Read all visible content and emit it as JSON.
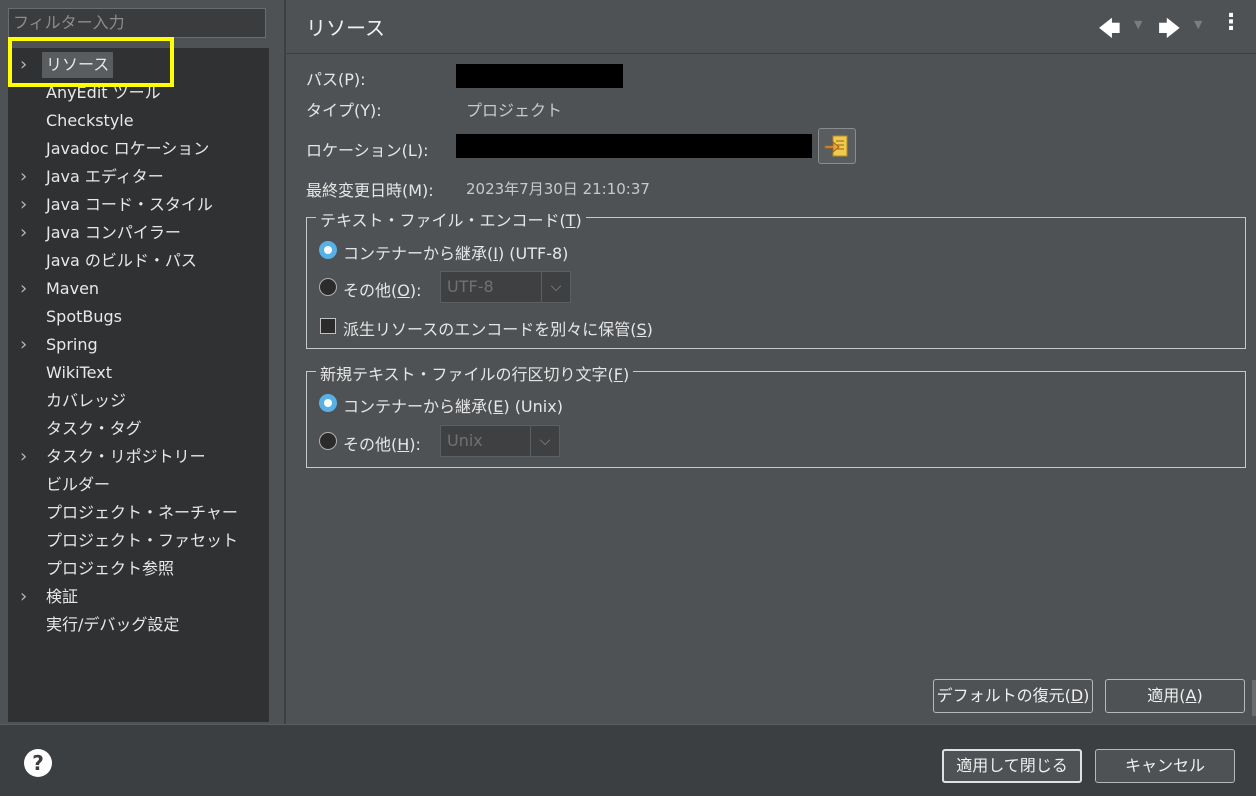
{
  "filter": {
    "placeholder": "フィルター入力"
  },
  "tree": {
    "items": [
      {
        "label": "リソース",
        "expandable": true,
        "selected": true
      },
      {
        "label": "AnyEdit ツール",
        "expandable": false
      },
      {
        "label": "Checkstyle",
        "expandable": false
      },
      {
        "label": "Javadoc ロケーション",
        "expandable": false
      },
      {
        "label": "Java エディター",
        "expandable": true
      },
      {
        "label": "Java コード・スタイル",
        "expandable": true
      },
      {
        "label": "Java コンパイラー",
        "expandable": true
      },
      {
        "label": "Java のビルド・パス",
        "expandable": false
      },
      {
        "label": "Maven",
        "expandable": true
      },
      {
        "label": "SpotBugs",
        "expandable": false
      },
      {
        "label": "Spring",
        "expandable": true
      },
      {
        "label": "WikiText",
        "expandable": false
      },
      {
        "label": "カバレッジ",
        "expandable": false
      },
      {
        "label": "タスク・タグ",
        "expandable": false
      },
      {
        "label": "タスク・リポジトリー",
        "expandable": true
      },
      {
        "label": "ビルダー",
        "expandable": false
      },
      {
        "label": "プロジェクト・ネーチャー",
        "expandable": false
      },
      {
        "label": "プロジェクト・ファセット",
        "expandable": false
      },
      {
        "label": "プロジェクト参照",
        "expandable": false
      },
      {
        "label": "検証",
        "expandable": true
      },
      {
        "label": "実行/デバッグ設定",
        "expandable": false
      }
    ]
  },
  "page": {
    "title": "リソース"
  },
  "nav": {
    "back_icon": "arrow-left-icon",
    "forward_icon": "arrow-right-icon",
    "menu_icon": "kebab-menu-icon"
  },
  "info": {
    "path_label": "パス(P):",
    "type_label": "タイプ(Y):",
    "type_value": "プロジェクト",
    "location_label": "ロケーション(L):",
    "modified_label": "最終変更日時(M):",
    "modified_value": "2023年7月30日 21:10:37"
  },
  "encoding": {
    "title_pre": "テキスト・ファイル・エンコード(",
    "title_key": "T",
    "title_post": ")",
    "inherit_pre": "コンテナーから継承(",
    "inherit_key": "I",
    "inherit_post": ") (UTF-8)",
    "other_pre": "その他(",
    "other_key": "O",
    "other_post": "):",
    "other_value": "UTF-8",
    "derived_pre": "派生リソースのエンコードを別々に保管(",
    "derived_key": "S",
    "derived_post": ")"
  },
  "line_delimiter": {
    "title_pre": "新規テキスト・ファイルの行区切り文字(",
    "title_key": "F",
    "title_post": ")",
    "inherit_pre": "コンテナーから継承(",
    "inherit_key": "E",
    "inherit_post": ") (Unix)",
    "other_pre": "その他(",
    "other_key": "H",
    "other_post": "):",
    "other_value": "Unix"
  },
  "buttons": {
    "restore_pre": "デフォルトの復元(",
    "restore_key": "D",
    "restore_post": ")",
    "apply_pre": "適用(",
    "apply_key": "A",
    "apply_post": ")",
    "apply_close": "適用して閉じる",
    "cancel": "キャンセル"
  },
  "colors": {
    "accent": "#58b1e6",
    "highlight": "#ffff00",
    "background": "#4f5254"
  }
}
